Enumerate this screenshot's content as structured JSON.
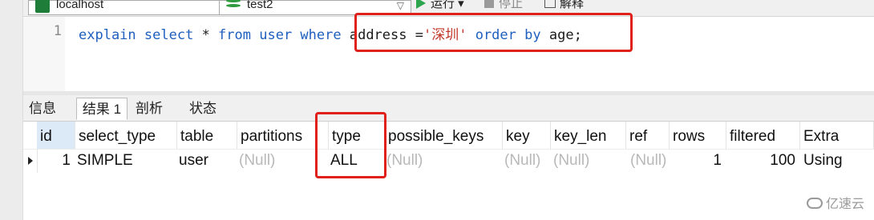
{
  "toolbar": {
    "connection": "localhost",
    "database": "test2",
    "run_label": "运行 ▾",
    "stop_label": "停止",
    "explain_label": "解释"
  },
  "editor": {
    "line_number": "1",
    "tokens": {
      "t1": "explain",
      "t2": " ",
      "t3": "select",
      "t4": " * ",
      "t5": "from",
      "t6": " user ",
      "t7": "where",
      "t8": " address =",
      "t9": "'深圳'",
      "t10": " ",
      "t11": "order",
      "t12": " ",
      "t13": "by",
      "t14": " age;"
    }
  },
  "result_tabs": [
    "信息",
    "结果 1",
    "剖析",
    "状态"
  ],
  "columns": [
    "id",
    "select_type",
    "table",
    "partitions",
    "type",
    "possible_keys",
    "key",
    "key_len",
    "ref",
    "rows",
    "filtered",
    "Extra"
  ],
  "rows": [
    [
      "1",
      "SIMPLE",
      "user",
      "(Null)",
      "ALL",
      "(Null)",
      "(Null)",
      "(Null)",
      "(Null)",
      "1",
      "100",
      "Using"
    ]
  ],
  "watermark": "亿速云",
  "colors": {
    "highlight": "#e0201a",
    "keyword": "#1f5fbf",
    "string": "#c0392b",
    "null_text": "#b8b8b8"
  }
}
